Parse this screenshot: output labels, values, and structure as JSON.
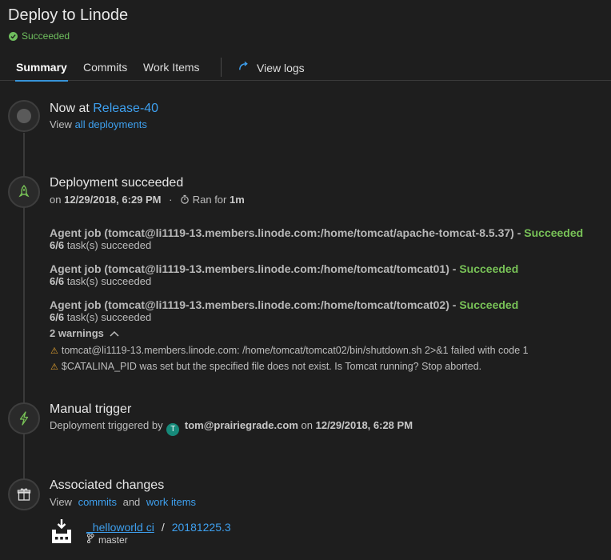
{
  "header": {
    "title": "Deploy to Linode",
    "status": "Succeeded"
  },
  "tabs": [
    {
      "label": "Summary",
      "active": true
    },
    {
      "label": "Commits",
      "active": false
    },
    {
      "label": "Work Items",
      "active": false
    }
  ],
  "view_logs_label": "View logs",
  "now_at": {
    "prefix": "Now at",
    "release": "Release-40",
    "view_prefix": "View",
    "all_deployments": "all deployments"
  },
  "deployment": {
    "title": "Deployment succeeded",
    "on_prefix": "on",
    "date": "12/29/2018, 6:29 PM",
    "separator": "·",
    "ran_for_prefix": "Ran for",
    "ran_for_value": "1m"
  },
  "jobs": [
    {
      "name": "Agent job (tomcat@li1119-13.members.linode.com:/home/tomcat/apache-tomcat-8.5.37)",
      "dash": "-",
      "status": "Succeeded",
      "tasks_count": "6/6",
      "tasks_suffix": "task(s) succeeded"
    },
    {
      "name": "Agent job (tomcat@li1119-13.members.linode.com:/home/tomcat/tomcat01)",
      "dash": "-",
      "status": "Succeeded",
      "tasks_count": "6/6",
      "tasks_suffix": "task(s) succeeded"
    },
    {
      "name": "Agent job (tomcat@li1119-13.members.linode.com:/home/tomcat/tomcat02)",
      "dash": "-",
      "status": "Succeeded",
      "tasks_count": "6/6",
      "tasks_suffix": "task(s) succeeded"
    }
  ],
  "warnings": {
    "toggle_label": "2 warnings",
    "items": [
      "tomcat@li1119-13.members.linode.com: /home/tomcat/tomcat02/bin/shutdown.sh 2>&1 failed with code 1",
      "$CATALINA_PID was set but the specified file does not exist. Is Tomcat running? Stop aborted."
    ]
  },
  "trigger": {
    "title": "Manual trigger",
    "prefix": "Deployment triggered by",
    "avatar_letter": "T",
    "user": "tom@prairiegrade.com",
    "on_word": "on",
    "date": "12/29/2018, 6:28 PM"
  },
  "changes": {
    "title": "Associated changes",
    "view_prefix": "View",
    "commits_link": "commits",
    "and_word": "and",
    "work_items_link": "work items",
    "repo": "_helloworld ci",
    "slash": "/",
    "build": "20181225.3",
    "branch": "master"
  },
  "colors": {
    "accent": "#3ea0ef",
    "success": "#78c257",
    "warning": "#e0a030",
    "background": "#1e1e1e"
  }
}
